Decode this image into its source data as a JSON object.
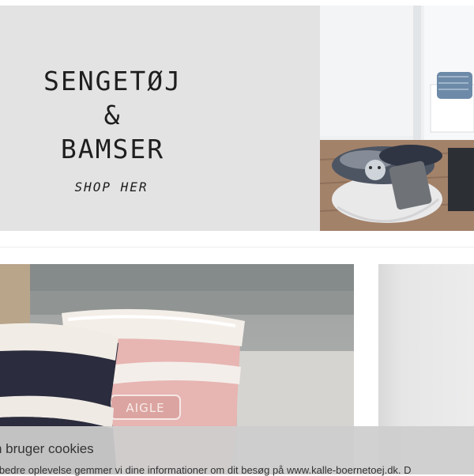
{
  "banner": {
    "heading_lines": [
      "SENGETØJ",
      "&",
      "BAMSER"
    ],
    "cta": "SHOP HER"
  },
  "product": {
    "brand_on_boot": "AIGLE"
  },
  "cookie_bar": {
    "title": "n bruger cookies",
    "text": "n bedre oplevelse gemmer vi dine informationer om dit besøg på www.kalle-boernetoej.dk. D"
  }
}
